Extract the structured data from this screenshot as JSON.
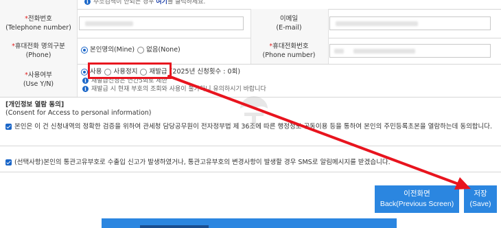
{
  "top_note": {
    "prefix": "주소검색이 안되는 경우 ",
    "link": "여기",
    "suffix": "를 클릭하세요."
  },
  "fields": {
    "telephone": {
      "label_ko": "전화번호",
      "label_en": "(Telephone number)"
    },
    "email": {
      "label_ko": "이메일",
      "label_en": "(E-mail)"
    },
    "phone_owner": {
      "label_ko": "휴대전화 명의구분",
      "label_en": "(Phone)",
      "options": [
        "본인명의(Mine)",
        "없음(None)"
      ]
    },
    "mobile": {
      "label_ko": "휴대전화번호",
      "label_en": "(Phone number)"
    },
    "use_status": {
      "label_ko": "사용여부",
      "label_en": "(Use Y/N)",
      "options": [
        "사용",
        "사용정지",
        "재발급"
      ],
      "count_text": "(2025년 신청횟수 : 0회)",
      "note1": "재발급신청은 연간5회로 제한",
      "note2": "재발급 시 현재 부호의 조회와 사용이 불가하니 유의하시기 바랍니다"
    }
  },
  "consent": {
    "title_ko": "[개인정보 열람 동의]",
    "title_en": "(Consent for Access to personal information)",
    "text1": "본인은 이 건 신청내역의 정확한 검증을 위하여 관세청 담당공무원이 전자정부법 제 36조에 따른 행정정보 공동이용 등을 통하여 본인의 주민등록초본을 열람하는데 동의합니다.",
    "text2": "(선택사항)본인의 통관고유부호로 수출입 신고가 발생하였거나, 통관고유부호의 변경사항이 발생할 경우 SMS로 알림메시지를 받겠습니다."
  },
  "buttons": {
    "back_ko": "이전화면",
    "back_en": "Back(Previous Screen)",
    "save_ko": "저장",
    "save_en": "(Save)"
  },
  "colors": {
    "accent": "#2b86e0",
    "highlight": "#e8141e"
  }
}
